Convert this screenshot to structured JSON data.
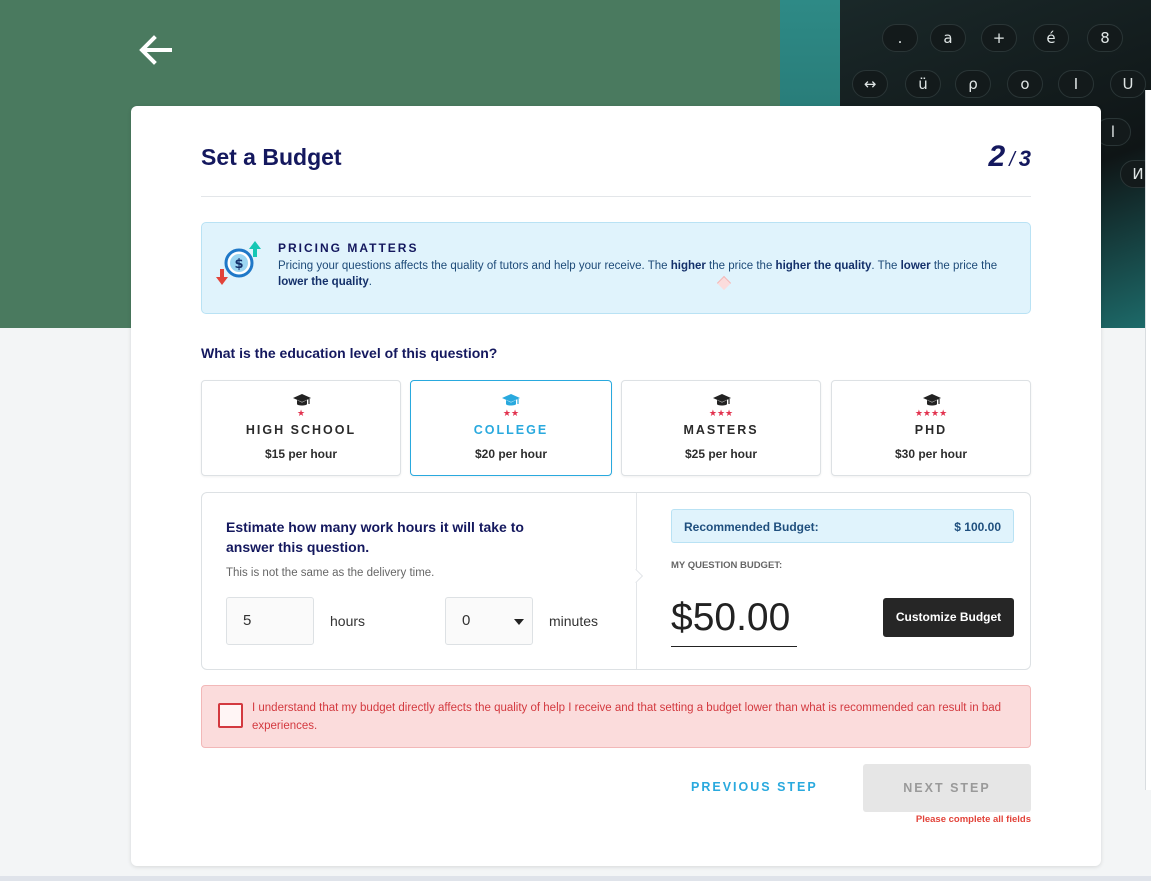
{
  "header": {
    "back_icon": "arrow-left-icon"
  },
  "hero": {
    "keys_row1": [
      ".",
      "a",
      "+",
      "é",
      "8"
    ],
    "keys_row2": [
      "↔",
      "ü",
      "ρ",
      "o",
      "I",
      "U"
    ],
    "keys_row3": [
      "l",
      "И"
    ]
  },
  "card": {
    "title": "Set a Budget",
    "step_current": "2",
    "step_separator": "/",
    "step_total": "3"
  },
  "info": {
    "icon": "dollar-arrows-icon",
    "heading": "PRICING MATTERS",
    "text_1": "Pricing your questions affects the quality of tutors and help your receive. The ",
    "bold_1": "higher",
    "text_2": " the price the ",
    "bold_2": "higher the quality",
    "text_3": ". The ",
    "bold_3": "lower",
    "text_4": " the price the ",
    "bold_4": "lower the quality",
    "text_5": ".",
    "colors": {
      "background": "#e0f3fc",
      "accent_up": "#16c7b4",
      "accent_down": "#e2433a",
      "coin": "#29a9de"
    }
  },
  "education": {
    "question": "What is the education level of this question?",
    "levels": [
      {
        "name": "HIGH SCHOOL",
        "stars": "★",
        "price": "$15 per hour",
        "selected": false
      },
      {
        "name": "COLLEGE",
        "stars": "★★",
        "price": "$20 per hour",
        "selected": true
      },
      {
        "name": "MASTERS",
        "stars": "★★★",
        "price": "$25 per hour",
        "selected": false
      },
      {
        "name": "PHD",
        "stars": "★★★★",
        "price": "$30 per hour",
        "selected": false
      }
    ],
    "cap_icon": "graduation-cap-icon"
  },
  "estimate": {
    "question": "Estimate how many work hours it will take to answer this question.",
    "note": "This is not the same as the delivery time.",
    "hours_value": "5",
    "hours_label": "hours",
    "minutes_value": "0",
    "minutes_label": "minutes"
  },
  "budget": {
    "recommended_label": "Recommended Budget:",
    "recommended_value": "$ 100.00",
    "my_budget_label": "MY QUESTION BUDGET:",
    "amount": "$50.00",
    "customize_label": "Customize Budget"
  },
  "warning": {
    "text": "I understand that my budget directly affects the quality of help I receive and that setting a budget lower than what is recommended can result in bad experiences.",
    "checked": false
  },
  "footer": {
    "previous_label": "PREVIOUS STEP",
    "next_label": "NEXT STEP",
    "error": "Please complete all fields"
  },
  "colors": {
    "brand_navy": "#14185e",
    "accent_blue": "#29a9de",
    "hero_green": "#4a7a5f",
    "star_red": "#e2334f",
    "error_red": "#d3393f"
  }
}
